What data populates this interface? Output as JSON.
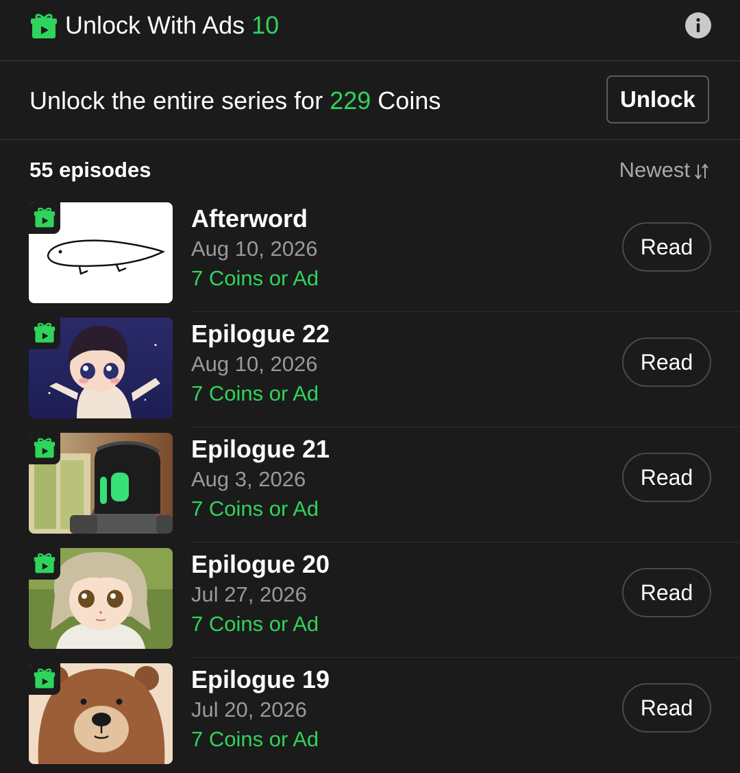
{
  "ads_bar": {
    "title": "Unlock With Ads",
    "count": "10",
    "icon": "gift-icon",
    "info_icon": "info-icon"
  },
  "series_unlock": {
    "prefix": "Unlock the entire series for",
    "coins": "229",
    "suffix": "Coins",
    "button_label": "Unlock"
  },
  "episodes_header": {
    "count_label": "55 episodes",
    "sort_label": "Newest",
    "sort_icon": "sort-arrows-icon"
  },
  "episodes": [
    {
      "title": "Afterword",
      "date": "Aug 10, 2026",
      "price": "7 Coins or Ad",
      "button": "Read",
      "thumb": "whale-doodle"
    },
    {
      "title": "Epilogue 22",
      "date": "Aug 10, 2026",
      "price": "7 Coins or Ad",
      "button": "Read",
      "thumb": "baby-boy"
    },
    {
      "title": "Epilogue 21",
      "date": "Aug 3, 2026",
      "price": "7 Coins or Ad",
      "button": "Read",
      "thumb": "robot"
    },
    {
      "title": "Epilogue 20",
      "date": "Jul 27, 2026",
      "price": "7 Coins or Ad",
      "button": "Read",
      "thumb": "girl"
    },
    {
      "title": "Epilogue 19",
      "date": "Jul 20, 2026",
      "price": "7 Coins or Ad",
      "button": "Read",
      "thumb": "bear"
    }
  ],
  "colors": {
    "background": "#1b1b1b",
    "accent_green": "#2fd45c",
    "secondary_text": "#9a9a9a",
    "divider": "#3a3a3a"
  }
}
